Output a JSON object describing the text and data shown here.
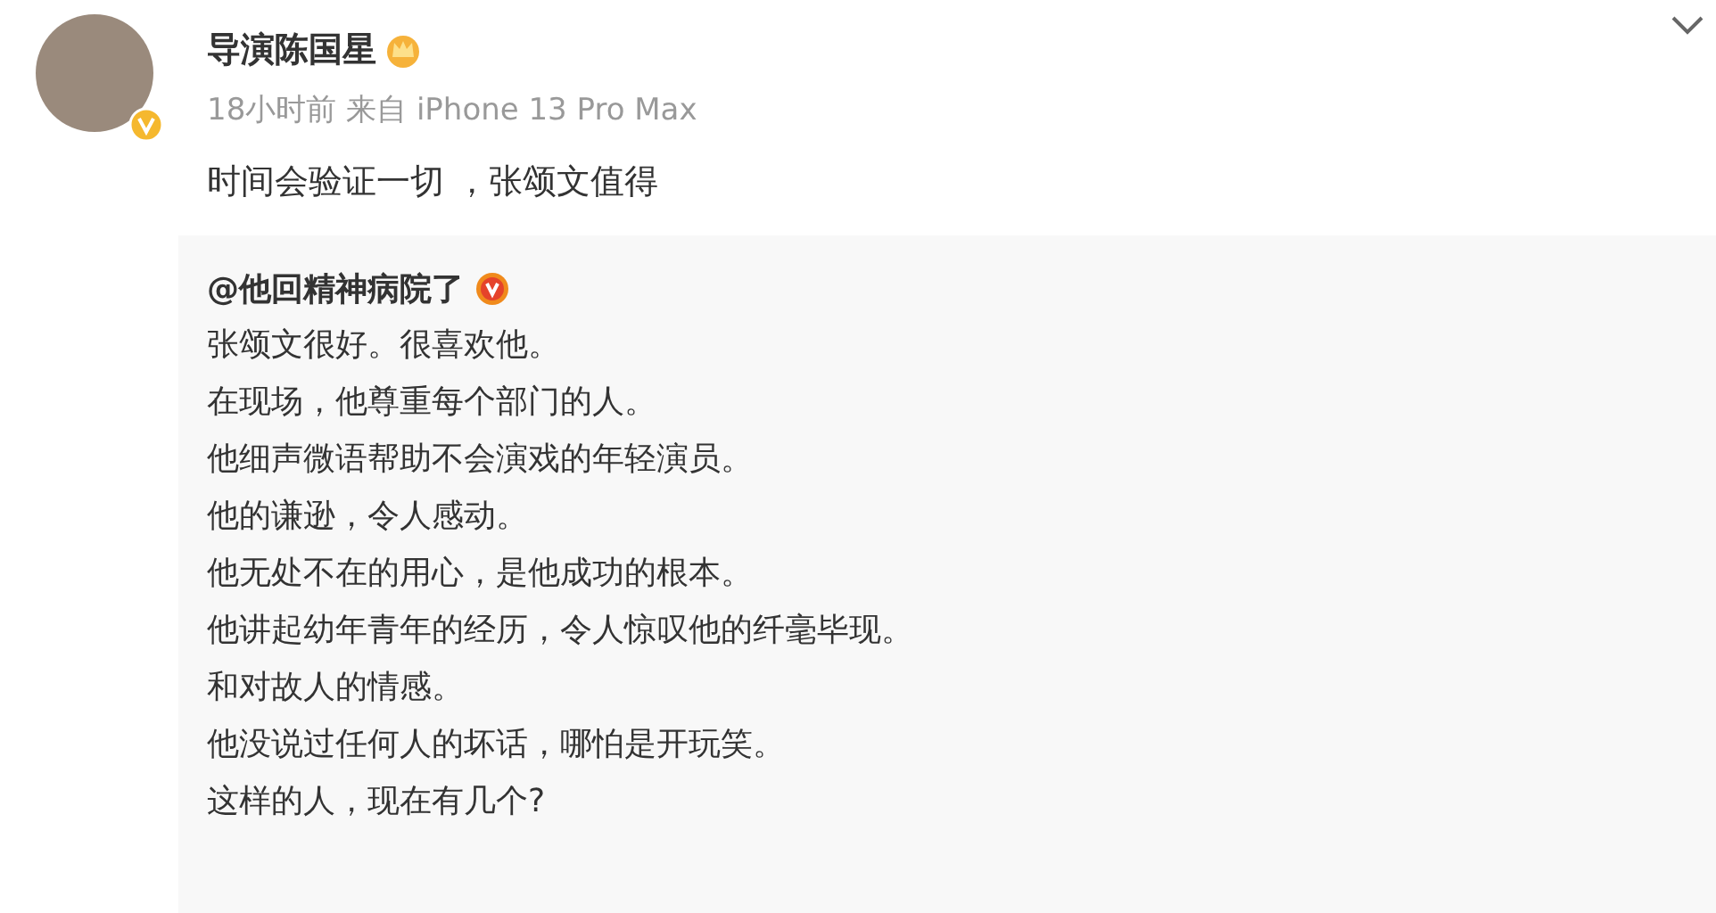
{
  "post": {
    "author": "导演陈国星",
    "meta": "18小时前 来自 iPhone 13 Pro Max",
    "text": "时间会验证一切 ，张颂文值得"
  },
  "repost": {
    "author": "@他回精神病院了",
    "lines": [
      "张颂文很好。很喜欢他。",
      "在现场，他尊重每个部门的人。",
      "他细声微语帮助不会演戏的年轻演员。",
      "他的谦逊，令人感动。",
      "他无处不在的用心，是他成功的根本。",
      "他讲起幼年青年的经历，令人惊叹他的纤毫毕现。",
      "和对故人的情感。",
      "他没说过任何人的坏话，哪怕是开玩笑。",
      "这样的人，现在有几个?"
    ]
  }
}
